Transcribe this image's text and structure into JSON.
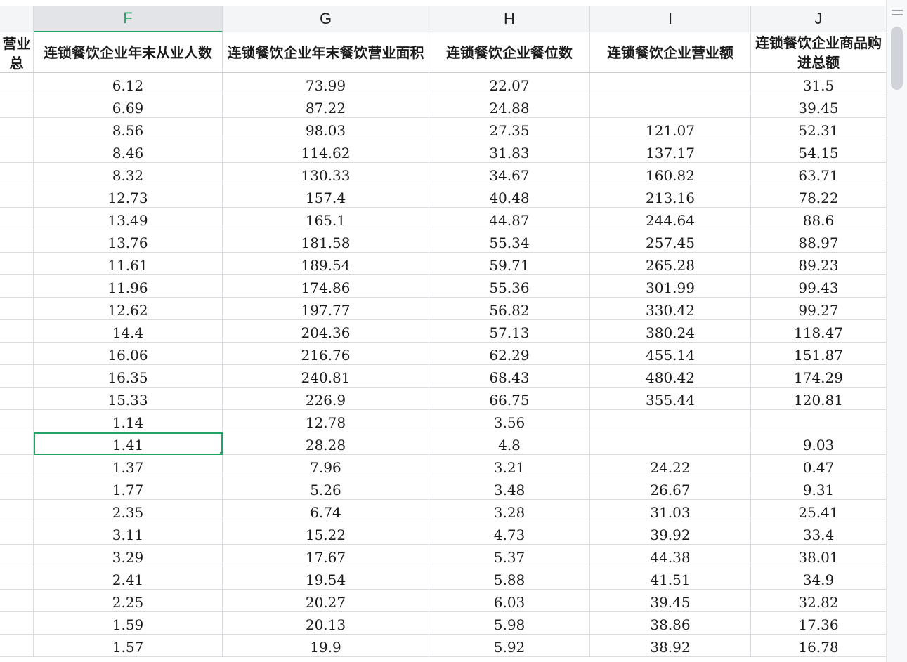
{
  "columns": {
    "f": "F",
    "g": "G",
    "h": "H",
    "i": "I",
    "j": "J"
  },
  "header_row": {
    "e": "营业总",
    "f": "连锁餐饮企业年末从业人数",
    "g": "连锁餐饮企业年末餐饮营业面积",
    "h": "连锁餐饮企业餐位数",
    "i": "连锁餐饮企业营业额",
    "j": "连锁餐饮企业商品购进总额"
  },
  "rows": [
    {
      "f": "6.12",
      "g": "73.99",
      "h": "22.07",
      "i": "",
      "j": "31.5"
    },
    {
      "f": "6.69",
      "g": "87.22",
      "h": "24.88",
      "i": "",
      "j": "39.45"
    },
    {
      "f": "8.56",
      "g": "98.03",
      "h": "27.35",
      "i": "121.07",
      "j": "52.31"
    },
    {
      "f": "8.46",
      "g": "114.62",
      "h": "31.83",
      "i": "137.17",
      "j": "54.15"
    },
    {
      "f": "8.32",
      "g": "130.33",
      "h": "34.67",
      "i": "160.82",
      "j": "63.71"
    },
    {
      "f": "12.73",
      "g": "157.4",
      "h": "40.48",
      "i": "213.16",
      "j": "78.22"
    },
    {
      "f": "13.49",
      "g": "165.1",
      "h": "44.87",
      "i": "244.64",
      "j": "88.6"
    },
    {
      "f": "13.76",
      "g": "181.58",
      "h": "55.34",
      "i": "257.45",
      "j": "88.97"
    },
    {
      "f": "11.61",
      "g": "189.54",
      "h": "59.71",
      "i": "265.28",
      "j": "89.23"
    },
    {
      "f": "11.96",
      "g": "174.86",
      "h": "55.36",
      "i": "301.99",
      "j": "99.43"
    },
    {
      "f": "12.62",
      "g": "197.77",
      "h": "56.82",
      "i": "330.42",
      "j": "99.27"
    },
    {
      "f": "14.4",
      "g": "204.36",
      "h": "57.13",
      "i": "380.24",
      "j": "118.47"
    },
    {
      "f": "16.06",
      "g": "216.76",
      "h": "62.29",
      "i": "455.14",
      "j": "151.87"
    },
    {
      "f": "16.35",
      "g": "240.81",
      "h": "68.43",
      "i": "480.42",
      "j": "174.29"
    },
    {
      "f": "15.33",
      "g": "226.9",
      "h": "66.75",
      "i": "355.44",
      "j": "120.81"
    },
    {
      "f": "1.14",
      "g": "12.78",
      "h": "3.56",
      "i": "",
      "j": ""
    },
    {
      "f": "1.41",
      "g": "28.28",
      "h": "4.8",
      "i": "",
      "j": "9.03"
    },
    {
      "f": "1.37",
      "g": "7.96",
      "h": "3.21",
      "i": "24.22",
      "j": "0.47"
    },
    {
      "f": "1.77",
      "g": "5.26",
      "h": "3.48",
      "i": "26.67",
      "j": "9.31"
    },
    {
      "f": "2.35",
      "g": "6.74",
      "h": "3.28",
      "i": "31.03",
      "j": "25.41"
    },
    {
      "f": "3.11",
      "g": "15.22",
      "h": "4.73",
      "i": "39.92",
      "j": "33.4"
    },
    {
      "f": "3.29",
      "g": "17.67",
      "h": "5.37",
      "i": "44.38",
      "j": "38.01"
    },
    {
      "f": "2.41",
      "g": "19.54",
      "h": "5.88",
      "i": "41.51",
      "j": "34.9"
    },
    {
      "f": "2.25",
      "g": "20.27",
      "h": "6.03",
      "i": "39.45",
      "j": "32.82"
    },
    {
      "f": "1.59",
      "g": "20.13",
      "h": "5.98",
      "i": "38.86",
      "j": "17.36"
    },
    {
      "f": "1.57",
      "g": "19.9",
      "h": "5.92",
      "i": "38.92",
      "j": "16.78"
    }
  ],
  "active_column": "F",
  "selected_row_index": 16,
  "accent_color": "#21a366"
}
